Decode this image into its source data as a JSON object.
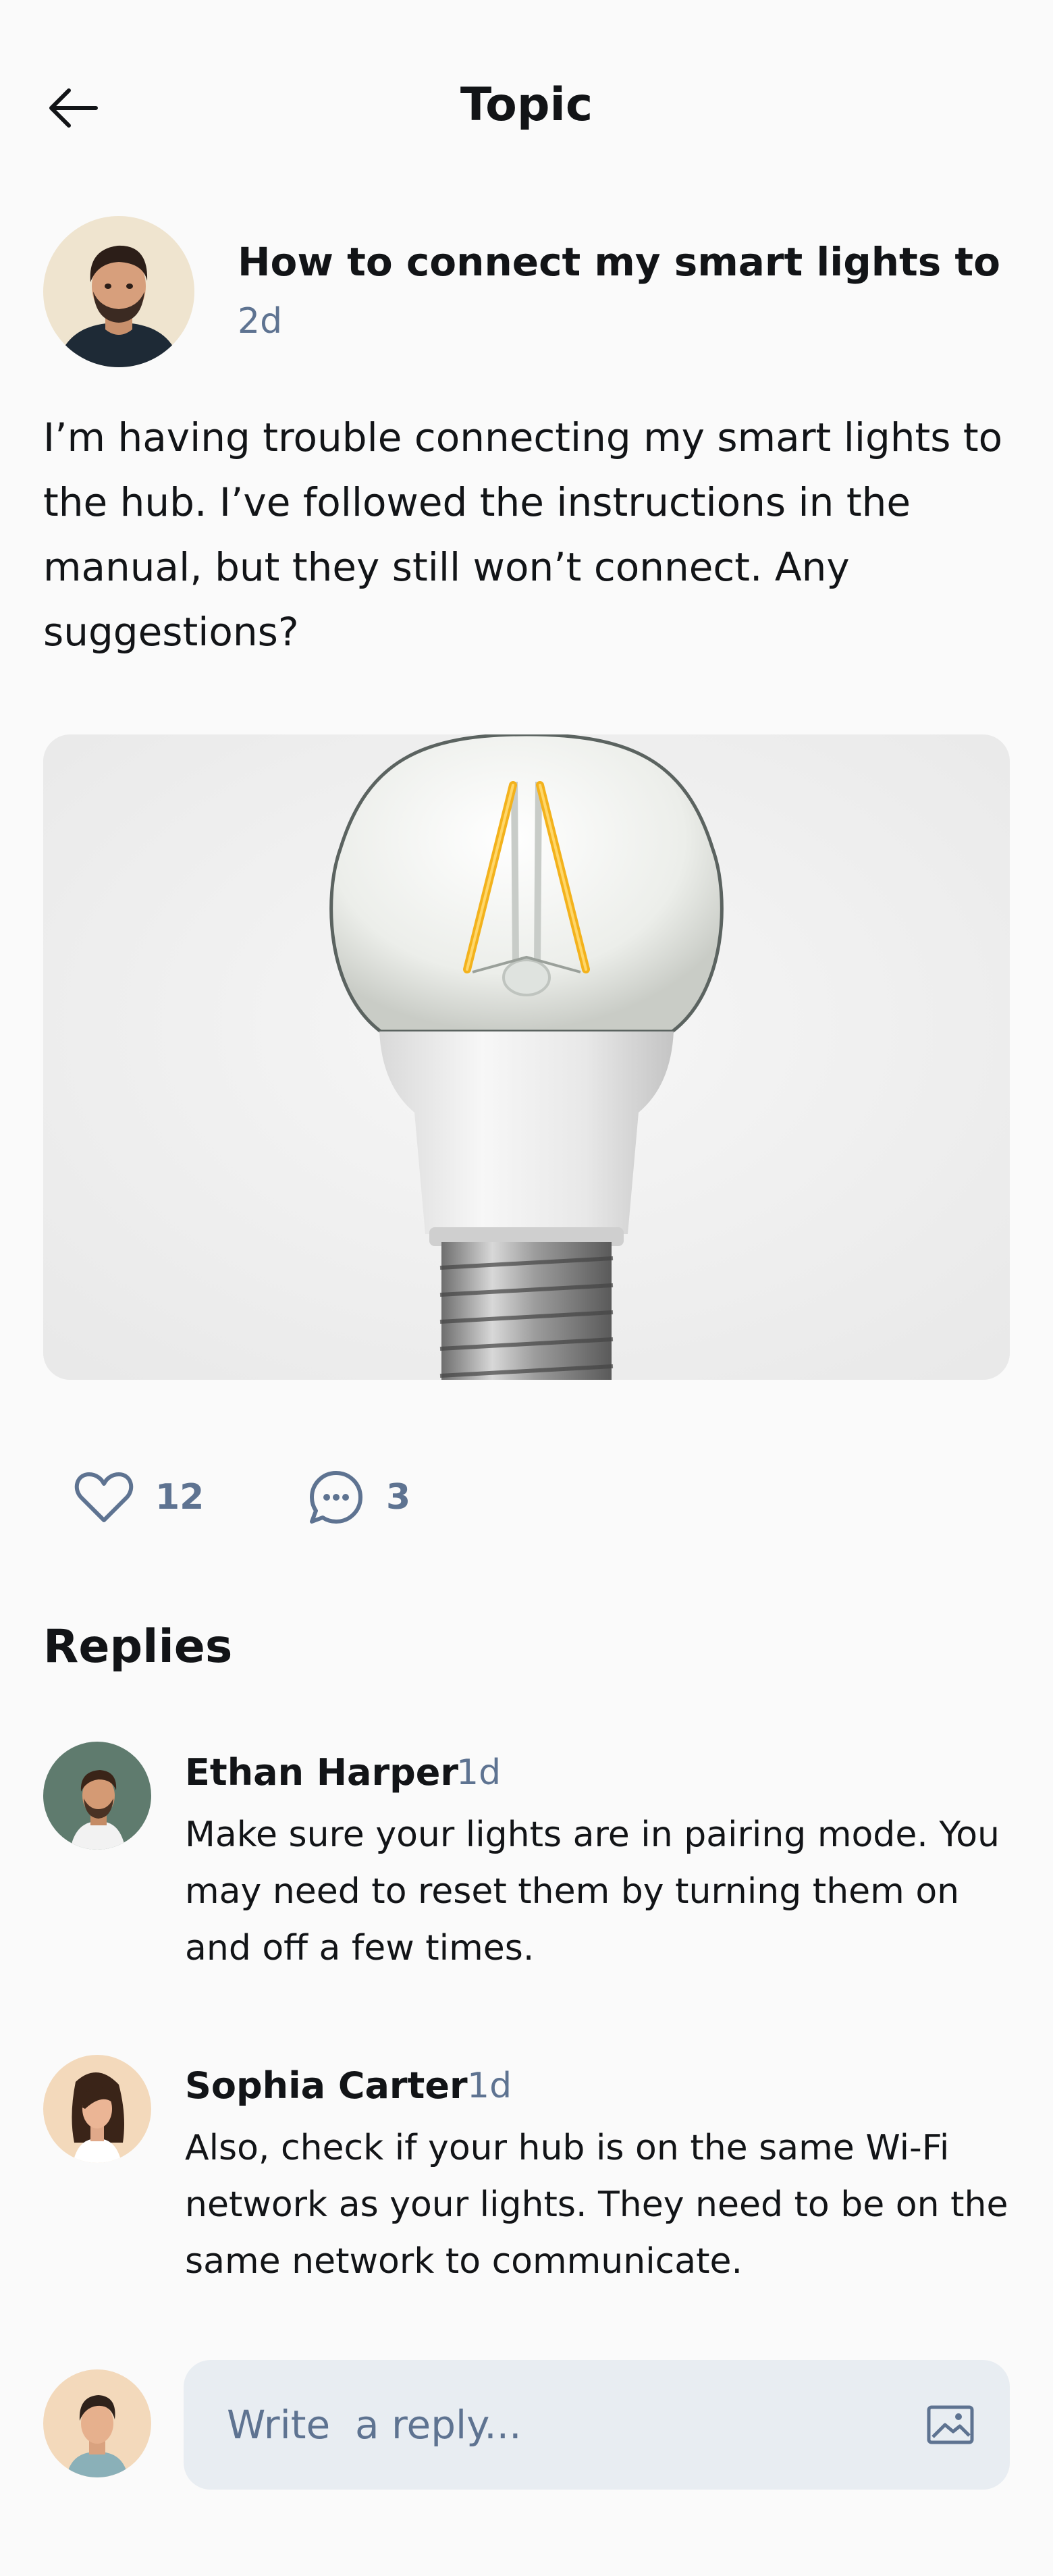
{
  "header": {
    "title": "Topic",
    "back_icon": "arrow-left-icon"
  },
  "post": {
    "title": "How to connect my smart lights to",
    "time": "2d",
    "body": "I’m having trouble connecting my smart lights to the hub. I’ve followed the instructions in the manual, but they still won’t connect. Any suggestions?",
    "image_subject": "light bulb",
    "likes": "12",
    "comments": "3",
    "like_icon": "heart-icon",
    "comment_icon": "chat-bubble-icon"
  },
  "replies": {
    "heading": "Replies",
    "items": [
      {
        "name": "Ethan Harper",
        "time": "1d",
        "text": "Make sure your lights are in pairing mode. You may need to reset them by turning them on and off a few times."
      },
      {
        "name": "Sophia Carter",
        "time": "1d",
        "text": "Also, check if your hub is on the same Wi-Fi network as your lights. They need to be on the same network to communicate."
      }
    ]
  },
  "composer": {
    "placeholder": "Write  a reply...",
    "image_icon": "image-icon"
  },
  "colors": {
    "background": "#fafafa",
    "text_primary": "#121417",
    "text_secondary": "#5e7391",
    "input_background": "#e8edf2"
  }
}
